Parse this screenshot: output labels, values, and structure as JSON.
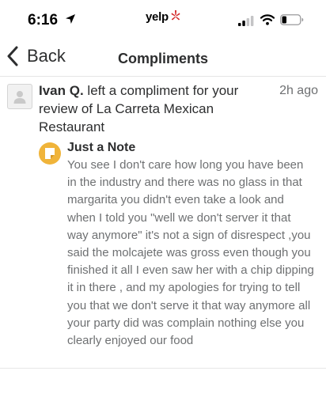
{
  "status_bar": {
    "time": "6:16",
    "carrier": "yelp",
    "icons": [
      "location-arrow-icon",
      "yelp-burst-icon",
      "cellular-signal-icon",
      "wifi-icon",
      "battery-icon"
    ]
  },
  "nav": {
    "back_label": "Back",
    "title": "Compliments",
    "back_icon": "chevron-left-icon"
  },
  "compliment": {
    "sender_name": "Ivan Q.",
    "summary_text": " left a compliment for your review of La Carreta Mexican Restaurant",
    "timestamp": "2h ago",
    "type_title": "Just a Note",
    "type_icon": "note-icon",
    "message": "You see I don't care how long you have been in the industry and there was no glass in that margarita you didn't even take a look and when I told you \"well we don't server it that way anymore\" it's not a sign of disrespect ,you said the molcajete was gross even though you finished it all I even saw her with a chip dipping it in there , and my apologies for trying to tell you that we don't serve it that way anymore all your party did was complain nothing else you clearly enjoyed our food"
  },
  "colors": {
    "yelp_red": "#d32323",
    "note_accent": "#f0b43a",
    "text_primary": "#2d2e2f",
    "text_secondary": "#6e7072",
    "divider": "#e6e6e6"
  }
}
